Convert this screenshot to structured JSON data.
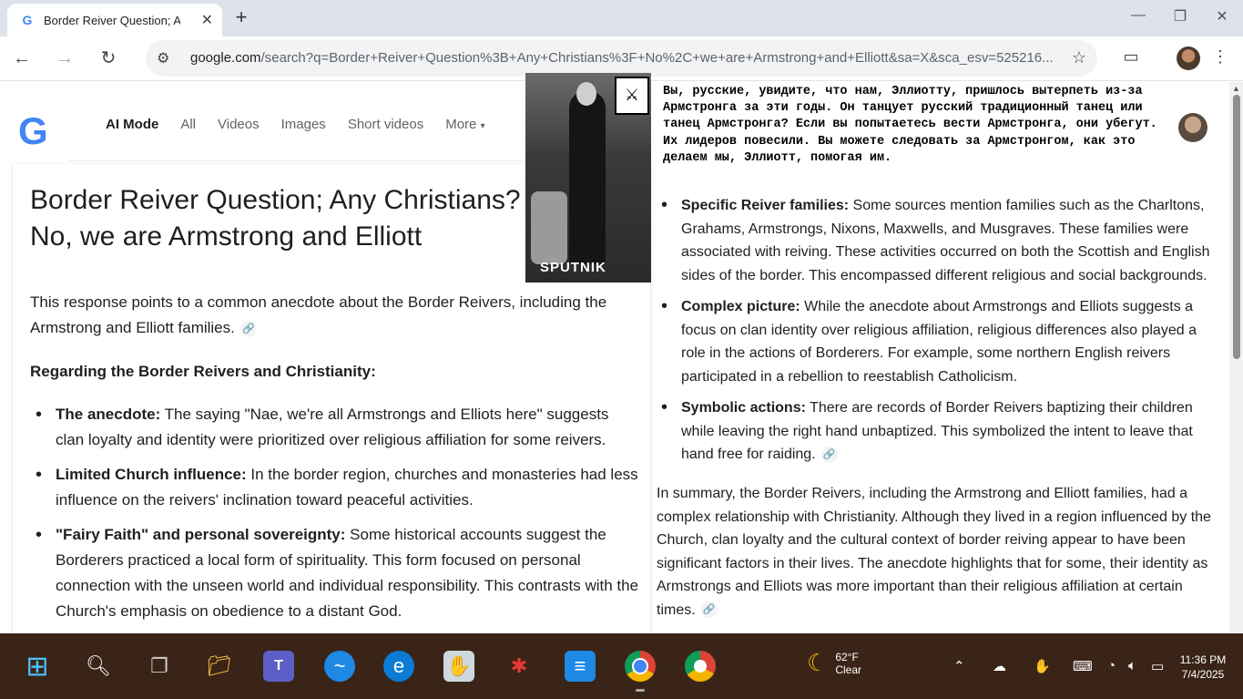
{
  "browser": {
    "tab_title": "Border Reiver Question; Any Christians?",
    "tab_favicon": "G",
    "new_tab": "+",
    "close": "✕",
    "url_host": "google.com",
    "url_path": "/search?q=Border+Reiver+Question%3B+Any+Christians%3F+No%2C+we+are+Armstrong+and+Elliott&sa=X&sca_esv=525216..."
  },
  "search": {
    "logo": "G",
    "tabs": [
      "AI Mode",
      "All",
      "Videos",
      "Images",
      "Short videos",
      "More"
    ]
  },
  "article": {
    "title": "Border Reiver Question; Any Christians? No, we are Armstrong and Elliott",
    "intro": "This response points to a common anecdote about the Border Reivers, including the Armstrong and Elliott families.",
    "heading": "Regarding the Border Reivers and Christianity:",
    "left_bullets": [
      {
        "term": "The anecdote:",
        "text": " The saying \"Nae, we're all Armstrongs and Elliots here\" suggests clan loyalty and identity were prioritized over religious affiliation for some reivers."
      },
      {
        "term": "Limited Church influence:",
        "text": " In the border region, churches and monasteries had less influence on the reivers' inclination toward peaceful activities."
      },
      {
        "term": "\"Fairy Faith\" and personal sovereignty:",
        "text": " Some historical accounts suggest the Borderers practiced a local form of spirituality. This form focused on personal connection with the unseen world and individual responsibility. This contrasts with the Church's emphasis on obedience to a distant God."
      }
    ],
    "right_bullets": [
      {
        "term": "Specific Reiver families:",
        "text": " Some sources mention families such as the Charltons, Grahams, Armstrongs, Nixons, Maxwells, and Musgraves. These families were associated with reiving. These activities occurred on both the Scottish and English sides of the border. This encompassed different religious and social backgrounds."
      },
      {
        "term": "Complex picture:",
        "text": " While the anecdote about Armstrongs and Elliots suggests a focus on clan identity over religious affiliation, religious differences also played a role in the actions of Borderers. For example, some northern English reivers participated in a rebellion to reestablish Catholicism."
      },
      {
        "term": "Symbolic actions:",
        "text": " There are records of Border Reivers baptizing their children while leaving the right hand unbaptized. This symbolized the intent to leave that hand free for raiding."
      }
    ],
    "summary": "In summary, the Border Reivers, including the Armstrong and Elliott families, had a complex relationship with Christianity. Although they lived in a region influenced by the Church, clan loyalty and the cultural context of border reiving appear to have been significant factors in their lives. The anecdote highlights that for some, their identity as Armstrongs and Elliots was more important than their religious affiliation at certain times."
  },
  "overlay": {
    "photo_brand": "SPUTNIK",
    "russian_text": "Вы, русские, увидите, что нам, Эллиотту, пришлось вытерпеть из-за Армстронга за эти годы. Он танцует русский традиционный танец или танец Армстронга? Если вы попытаетесь вести Армстронга, они убегут. Их лидеров повесили. Вы можете следовать за Армстронгом, как это делаем мы, Эллиотт, помогая им."
  },
  "taskbar": {
    "weather_temp": "62°F",
    "weather_desc": "Clear",
    "time": "11:36 PM",
    "date": "7/4/2025"
  },
  "colors": {
    "accent_blue": "#4285f4",
    "taskbar_bg": "#3a2418"
  }
}
